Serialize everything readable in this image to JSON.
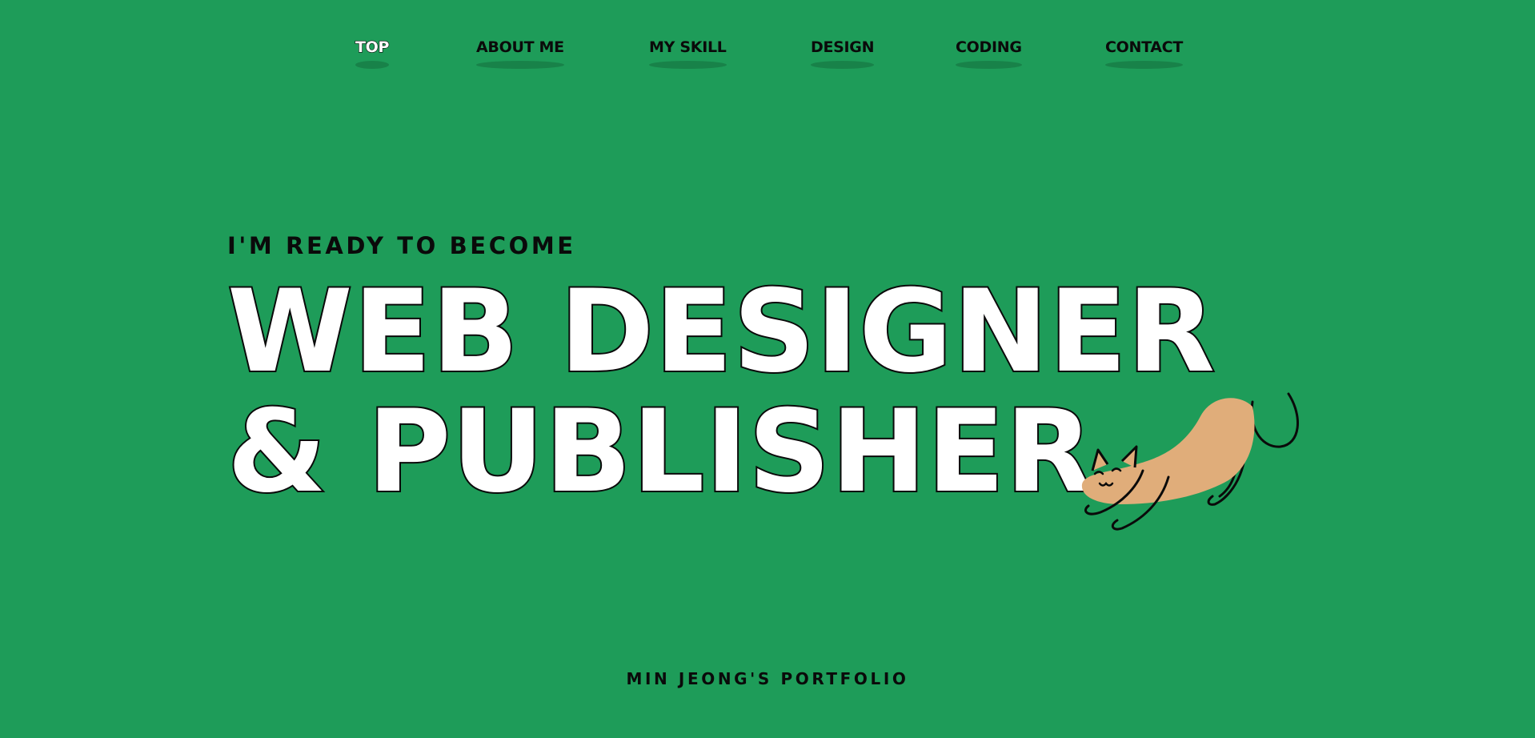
{
  "nav": {
    "items": [
      {
        "label": "TOP",
        "active": true
      },
      {
        "label": "ABOUT ME",
        "active": false
      },
      {
        "label": "MY SKILL",
        "active": false
      },
      {
        "label": "DESIGN",
        "active": false
      },
      {
        "label": "CODING",
        "active": false
      },
      {
        "label": "CONTACT",
        "active": false
      }
    ]
  },
  "hero": {
    "subtitle": "I'M READY TO BECOME",
    "headline_line1": "WEB DESIGNER",
    "headline_line2": "& PUBLISHER",
    "illustration": "stretching-cat-illustration"
  },
  "footer": {
    "label": "MIN JEONG'S PORTFOLIO"
  },
  "colors": {
    "background": "#1e9c59",
    "text": "#0a0a0a",
    "headline_fill": "#ffffff",
    "cat_fill": "#e0ad7a"
  }
}
